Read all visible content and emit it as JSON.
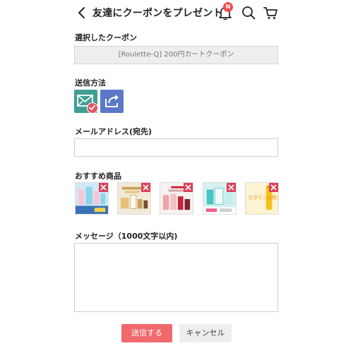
{
  "header": {
    "title": "友達にクーポンをプレゼント",
    "notification_badge": "N",
    "icons": [
      "back-chevron-icon",
      "bell-icon",
      "search-icon",
      "cart-icon"
    ]
  },
  "coupon_section": {
    "label": "選択したクーポン",
    "selected_coupon": "[Roulette-Q] 200円カートクーポン"
  },
  "send_method": {
    "label": "送信方法",
    "options": [
      {
        "icon": "mail-icon",
        "selected": true
      },
      {
        "icon": "share-icon",
        "selected": false
      }
    ]
  },
  "email": {
    "label": "メールアドレス(宛先)",
    "value": "",
    "placeholder": ""
  },
  "recommended": {
    "label": "おすすめ商品",
    "items": [
      {
        "thumb_text": "",
        "colors": [
          "#cfe9f5",
          "#f4c7d6",
          "#8fd3e8"
        ]
      },
      {
        "thumb_text": "",
        "colors": [
          "#f2ead8",
          "#e8c27a",
          "#c6a25a"
        ]
      },
      {
        "thumb_text": "",
        "colors": [
          "#f7f2ef",
          "#e9a5a8",
          "#c7223a"
        ]
      },
      {
        "thumb_text": "",
        "colors": [
          "#d6f1ef",
          "#46c3c3",
          "#f15a8a"
        ]
      },
      {
        "thumb_text": "ビタミン化粧水",
        "colors": [
          "#fbf3d2",
          "#f2c21f",
          "#f29b12"
        ]
      }
    ]
  },
  "message": {
    "label": "メッセージ（1000文字以内)",
    "value": "",
    "placeholder": ""
  },
  "buttons": {
    "send": "送信する",
    "cancel": "キャンセル"
  },
  "colors": {
    "accent": "#f06a6d",
    "badge": "#f0504a",
    "remove": "#d9435a",
    "mail_bg": "#3f9e96",
    "share_bg": "#5b79c8"
  }
}
